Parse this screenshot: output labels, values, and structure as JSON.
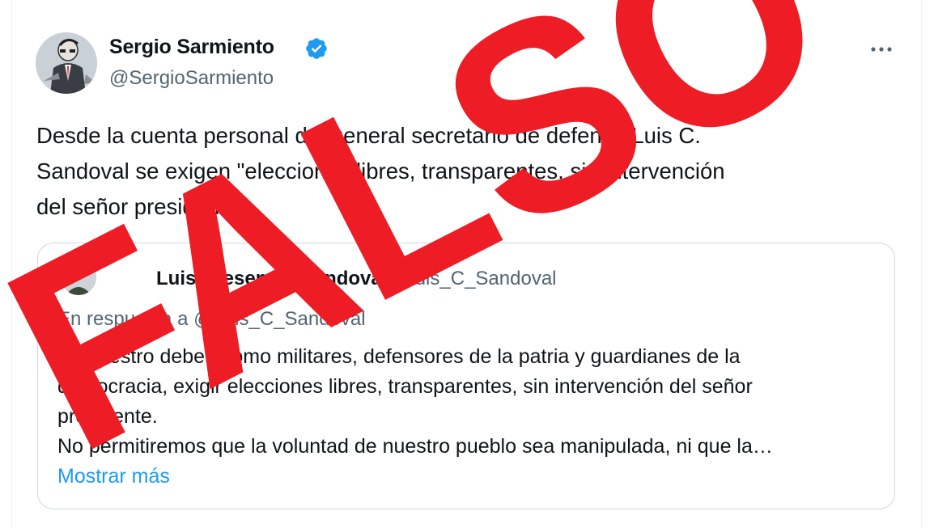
{
  "tweet": {
    "author": {
      "name": "Sergio Sarmiento",
      "handle": "@SergioSarmiento",
      "verified": true
    },
    "text_lines": [
      "Desde la cuenta personal del general secretario de defensa Luis C.",
      "Sandoval se exigen \"elecciones libres, transparentes, sin intervención",
      "del señor presidente\"."
    ],
    "more_icon": "more-horizontal-icon"
  },
  "quote": {
    "author_name": "Luis Cresencio Sandoval Gl",
    "handle": "@Luis_C_Sandoval",
    "reply_text": "En respuesta a @Luis_C_Sandoval",
    "text_lines": [
      "Es nuestro deber, como militares, defensores de la patria y guardianes de la",
      "democracia, exigir elecciones libres, transparentes, sin intervención del señor",
      "presidente.",
      "No permitiremos que la voluntad de nuestro pueblo sea manipulada, ni que la…"
    ],
    "show_more": "Mostrar más"
  },
  "stamp": {
    "text": "FALSO",
    "color": "#ee1c25"
  },
  "colors": {
    "text": "#0f1419",
    "secondary": "#536471",
    "link": "#1d9bf0",
    "verified": "#1d9bf0",
    "border": "#cfd9de"
  }
}
